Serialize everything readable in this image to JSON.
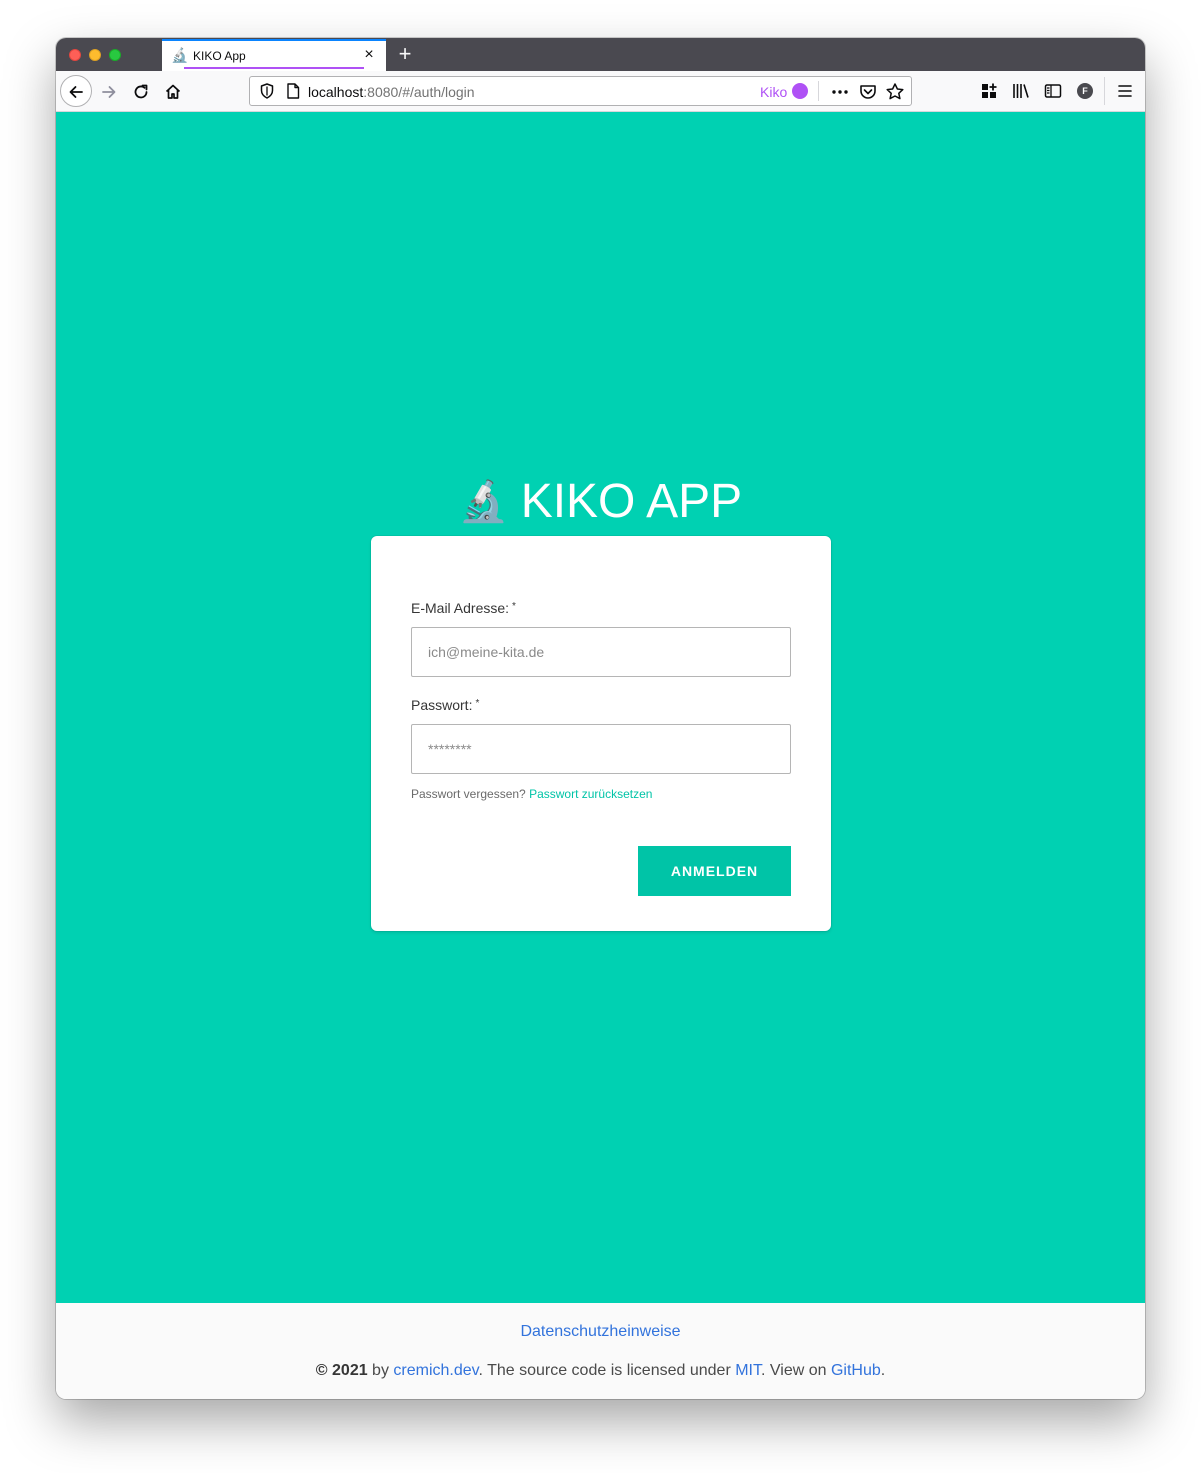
{
  "browser": {
    "tab": {
      "favicon": "🔬",
      "title": "KIKO App",
      "close": "×"
    },
    "new_tab": "+",
    "url": {
      "host": "localhost",
      "rest": ":8080/#/auth/login",
      "container_label": "Kiko",
      "container_color": "#af51f5"
    },
    "icons": [
      "back-arrow-icon",
      "forward-arrow-icon",
      "reload-icon",
      "home-icon",
      "tracking-shield-icon",
      "page-info-icon",
      "more-actions-icon",
      "pocket-icon",
      "bookmark-star-icon",
      "extensions-icon",
      "library-icon",
      "sidebar-icon",
      "account-icon",
      "menu-icon"
    ],
    "account_initial": "F"
  },
  "app": {
    "brand_emoji": "🔬",
    "brand_name": "KIKO APP",
    "accent_color": "#00d1b2"
  },
  "login": {
    "email_label": "E-Mail Adresse:",
    "email_required": "*",
    "email_placeholder": "ich@meine-kita.de",
    "password_label": "Passwort:",
    "password_required": "*",
    "password_placeholder": "********",
    "forgot_text": "Passwort vergessen?",
    "reset_link": "Passwort zurücksetzen",
    "submit_label": "ANMELDEN"
  },
  "footer": {
    "privacy_link": "Datenschutzheinweise",
    "copyright": "© 2021",
    "by": " by ",
    "author_link": "cremich.dev",
    "license_text": ". The source code is licensed under ",
    "license_link": "MIT",
    "view_text": ". View on ",
    "github_link": "GitHub",
    "end": "."
  }
}
